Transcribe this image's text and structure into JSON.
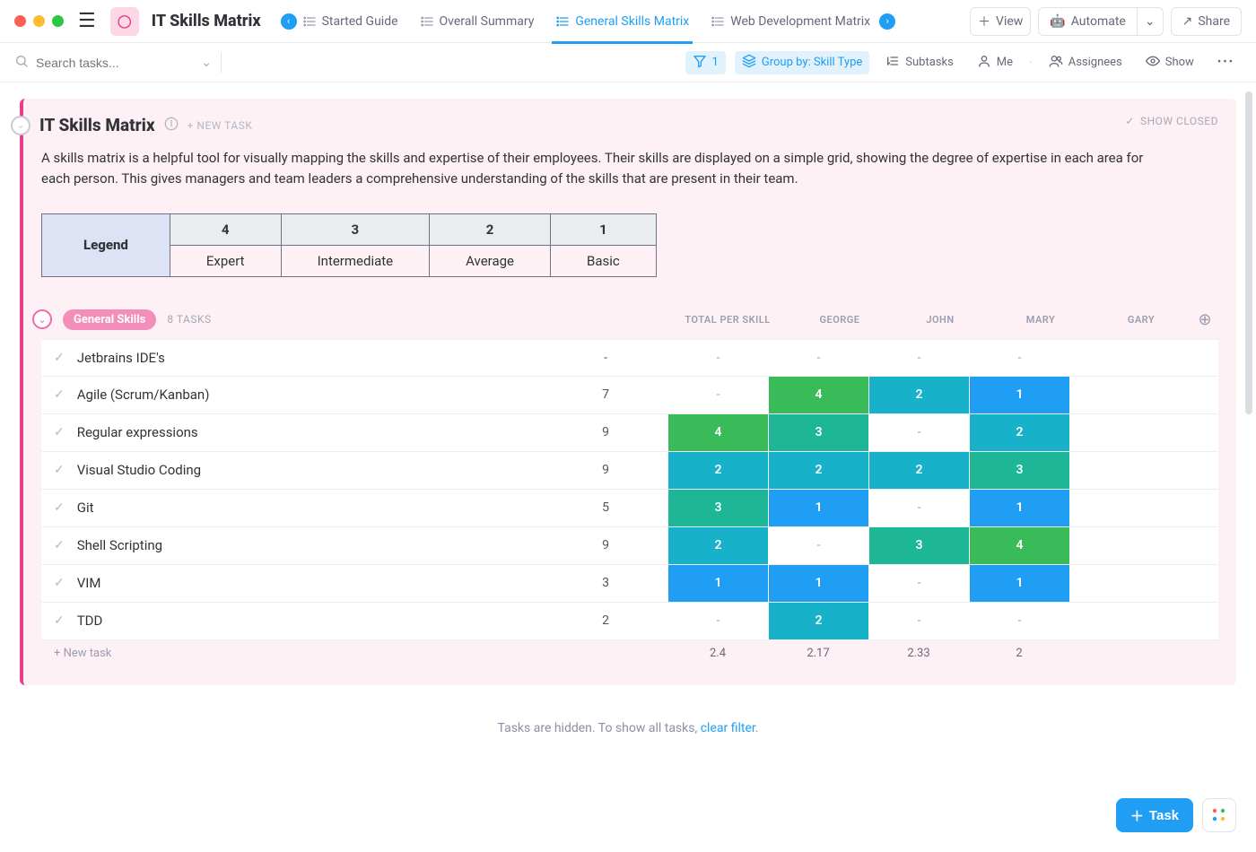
{
  "app": {
    "title": "IT Skills Matrix"
  },
  "tabs": [
    {
      "label": "Started Guide",
      "active": false,
      "has_nav_left": true
    },
    {
      "label": "Overall Summary",
      "active": false
    },
    {
      "label": "General Skills Matrix",
      "active": true
    },
    {
      "label": "Web Development Matrix",
      "active": false,
      "has_nav_right": true,
      "truncated": true
    }
  ],
  "topbar": {
    "view": "View",
    "automate": "Automate",
    "share": "Share"
  },
  "toolbar": {
    "search_placeholder": "Search tasks...",
    "filter_count": "1",
    "group_by": "Group by: Skill Type",
    "subtasks": "Subtasks",
    "me": "Me",
    "assignees": "Assignees",
    "show": "Show"
  },
  "card": {
    "title": "IT Skills Matrix",
    "new_task": "+ NEW TASK",
    "show_closed": "SHOW CLOSED",
    "description": "A skills matrix is a helpful tool for visually mapping the skills and expertise of their employees. Their skills are displayed on a simple grid, showing the degree of expertise in each area for each person. This gives managers and team leaders a comprehensive understanding of the skills that are present in their team."
  },
  "legend": {
    "header": "Legend",
    "cols": [
      "4",
      "3",
      "2",
      "1"
    ],
    "labels": [
      "Expert",
      "Intermediate",
      "Average",
      "Basic"
    ]
  },
  "group": {
    "name": "General Skills",
    "count": "8 TASKS",
    "columns": [
      "TOTAL PER SKILL",
      "GEORGE",
      "JOHN",
      "MARY",
      "GARY"
    ]
  },
  "colors": {
    "4": "#3abb59",
    "3": "#1db696",
    "2": "#17b1c9",
    "1": "#1f9ef4"
  },
  "rows": [
    {
      "name": "Jetbrains IDE's",
      "total": "-",
      "cells": [
        "-",
        "-",
        "-",
        "-"
      ]
    },
    {
      "name": "Agile (Scrum/Kanban)",
      "total": "7",
      "cells": [
        "-",
        "4",
        "2",
        "1"
      ]
    },
    {
      "name": "Regular expressions",
      "total": "9",
      "cells": [
        "4",
        "3",
        "-",
        "2"
      ]
    },
    {
      "name": "Visual Studio Coding",
      "total": "9",
      "cells": [
        "2",
        "2",
        "2",
        "3"
      ]
    },
    {
      "name": "Git",
      "total": "5",
      "cells": [
        "3",
        "1",
        "-",
        "1"
      ]
    },
    {
      "name": "Shell Scripting",
      "total": "9",
      "cells": [
        "2",
        "-",
        "3",
        "4"
      ]
    },
    {
      "name": "VIM",
      "total": "3",
      "cells": [
        "1",
        "1",
        "-",
        "1"
      ]
    },
    {
      "name": "TDD",
      "total": "2",
      "cells": [
        "-",
        "2",
        "-",
        "-"
      ]
    }
  ],
  "averages": [
    "2.4",
    "2.17",
    "2.33",
    "2"
  ],
  "footer": {
    "new_task": "+ New task",
    "hidden_prefix": "Tasks are hidden. To show all tasks, ",
    "clear_filter": "clear filter",
    "period": "."
  },
  "fab": {
    "task": "Task"
  }
}
